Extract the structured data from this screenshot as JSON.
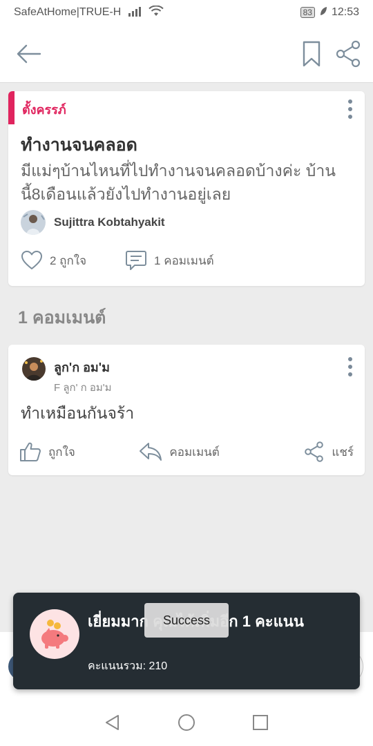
{
  "status_bar": {
    "carrier": "SafeAtHome|TRUE-H",
    "battery": "83",
    "time": "12:53"
  },
  "post": {
    "tag": "ตั้งครรภ์",
    "title": "ทำงานจนคลอด",
    "body": "มีแม่ๆบ้านไหนที่ไปทำงานจนคลอดบ้างค่ะ บ้านนี้8เดือนแล้วยังไปทำงานอยู่เลย",
    "author": "Sujittra Kobtahyakit",
    "likes": "2 ถูกใจ",
    "comments": "1 คอมเมนต์"
  },
  "comments_heading": "1 คอมเมนต์",
  "comment": {
    "author": "ลูก'ก อม'ม",
    "sub": "F ลูก' ก อม'ม",
    "text": "ทำเหมือนกันจร้า",
    "like_label": "ถูกใจ",
    "reply_label": "คอมเมนต์",
    "share_label": "แชร์"
  },
  "toast": {
    "title": "เยี่ยมมาก คุณได้เพิ่มอีก 1 คะแนน",
    "total": "คะแนนรวม: 210"
  },
  "success_chip": "Success",
  "colors": {
    "accent": "#e0245e",
    "toast_bg": "#252d33",
    "icon_gray": "#7a8a99"
  }
}
